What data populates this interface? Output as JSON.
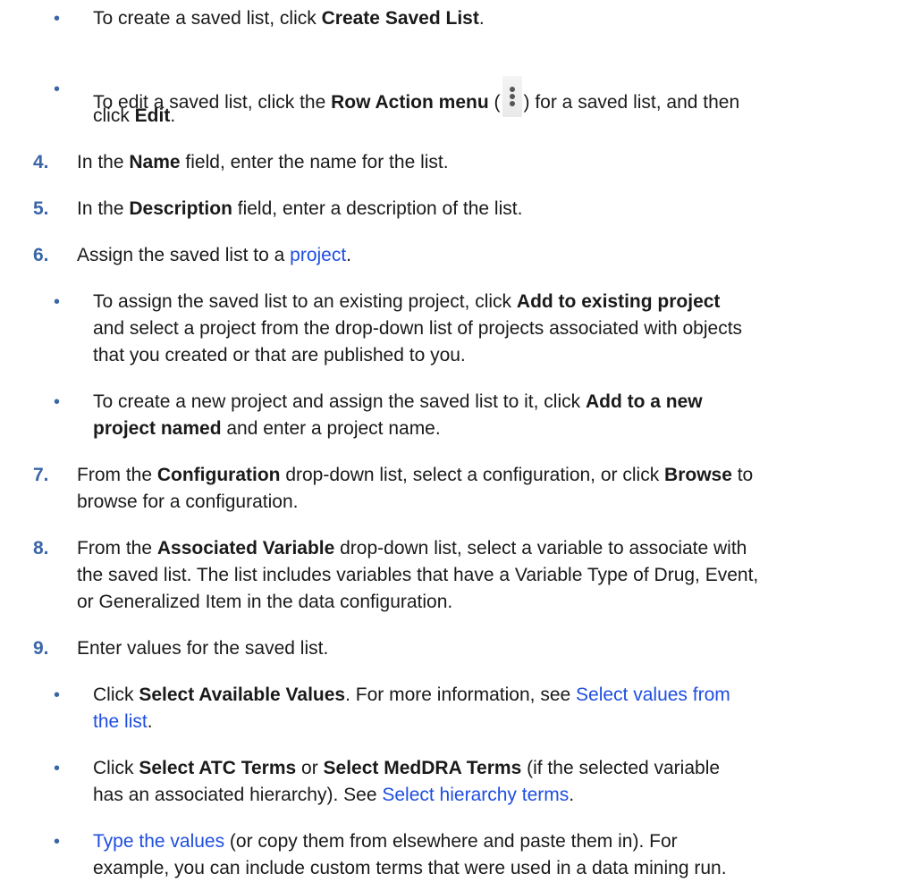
{
  "bullet_glyph": "•",
  "b1": {
    "pre": "To create a saved list, click ",
    "bold": "Create Saved List",
    "post": "."
  },
  "b2": {
    "pre": "To edit a saved list, click the ",
    "bold": "Row Action menu",
    "paren_open": " (",
    "paren_close": ") for a saved list, and then",
    "line2_pre": "click ",
    "line2_bold": "Edit",
    "line2_post": "."
  },
  "icons": {
    "row_action": "kebab-vertical-dots-icon"
  },
  "step4": {
    "num": "4.",
    "pre": "In the ",
    "bold": "Name",
    "post": " field, enter the name for the list."
  },
  "step5": {
    "num": "5.",
    "pre": "In the ",
    "bold": "Description",
    "post": " field, enter a description of the list."
  },
  "step6": {
    "num": "6.",
    "pre": "Assign the saved list to a ",
    "link": "project",
    "post": "."
  },
  "s6b1": {
    "pre": "To assign the saved list to an existing project, click ",
    "bold": "Add to existing project",
    "l2": "and select a project from the drop-down list of projects associated with objects",
    "l3": "that you created or that are published to you."
  },
  "s6b2": {
    "pre": "To create a new project and assign the saved list to it, click ",
    "bold": "Add to a new",
    "l2_bold": "project named",
    "l2_post": " and enter a project name."
  },
  "step7": {
    "num": "7.",
    "pre": "From the ",
    "bold": "Configuration",
    "mid": " drop-down list, select a configuration, or click ",
    "bold2": "Browse",
    "post": " to",
    "l2": "browse for a configuration."
  },
  "step8": {
    "num": "8.",
    "pre": "From the ",
    "bold": "Associated Variable",
    "post": " drop-down list, select a variable to associate with",
    "l2": "the saved list. The list includes variables that have a Variable Type of Drug, Event,",
    "l3": "or Generalized Item in the data configuration."
  },
  "step9": {
    "num": "9.",
    "text": "Enter values for the saved list."
  },
  "s9b1": {
    "pre": "Click ",
    "bold": "Select Available Values",
    "post": ". For more information, see ",
    "link1": "Select values from",
    "link2": "the list",
    "end": "."
  },
  "s9b2": {
    "pre": "Click ",
    "bold": "Select ATC Terms",
    "mid": " or ",
    "bold2": "Select MedDRA Terms",
    "post": " (if the selected variable",
    "l2": "has an associated hierarchy). See ",
    "link": "Select hierarchy terms",
    "end": "."
  },
  "s9b3": {
    "link": "Type the values",
    "post": " (or copy them from elsewhere and paste them in). For",
    "l2": "example, you can include custom terms that were used in a data mining run."
  },
  "colors": {
    "accent": "#3a66a8",
    "link": "#1f4ee0",
    "text": "#1a1a1a"
  }
}
